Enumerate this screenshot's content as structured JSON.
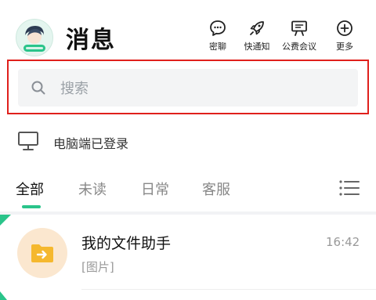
{
  "header": {
    "title": "消息",
    "actions": [
      {
        "id": "secret-chat",
        "label": "密聊",
        "icon": "chat-bubble-icon"
      },
      {
        "id": "quick-notify",
        "label": "快通知",
        "icon": "rocket-icon"
      },
      {
        "id": "public-meeting",
        "label": "公费会议",
        "icon": "presentation-icon"
      },
      {
        "id": "more",
        "label": "更多",
        "icon": "plus-circle-icon"
      }
    ]
  },
  "search": {
    "placeholder": "搜索"
  },
  "pc_status": {
    "text": "电脑端已登录",
    "icon": "monitor-icon"
  },
  "tabs": [
    {
      "label": "全部",
      "active": true
    },
    {
      "label": "未读",
      "active": false
    },
    {
      "label": "日常",
      "active": false
    },
    {
      "label": "客服",
      "active": false
    }
  ],
  "conversations": [
    {
      "name": "我的文件助手",
      "preview": "[图片]",
      "time": "16:42",
      "icon": "folder-arrow-icon",
      "pinned": true
    }
  ],
  "colors": {
    "accent": "#2ac48a",
    "highlight_frame": "#e0201c",
    "folder_bg": "#fbe7cf",
    "folder": "#f5b82e"
  }
}
